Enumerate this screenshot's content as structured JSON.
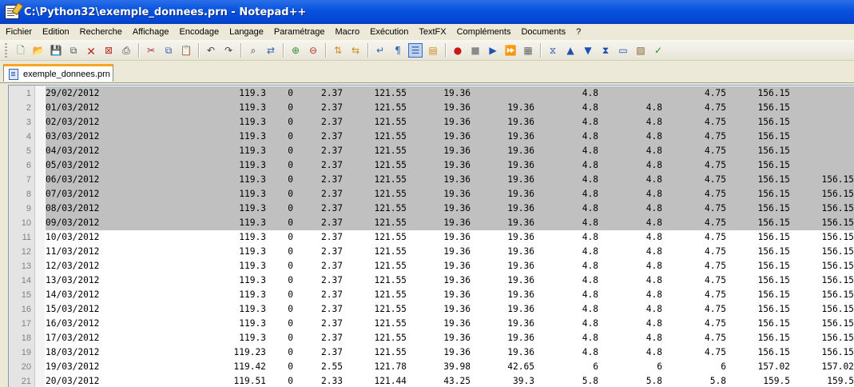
{
  "window": {
    "title": "C:\\Python32\\exemple_donnees.prn - Notepad++"
  },
  "menu": [
    "Fichier",
    "Edition",
    "Recherche",
    "Affichage",
    "Encodage",
    "Langage",
    "Paramétrage",
    "Macro",
    "Exécution",
    "TextFX",
    "Compléments",
    "Documents",
    "?"
  ],
  "toolbar": {
    "buttons": [
      {
        "name": "new-file-icon",
        "glyph": "🗋",
        "color": "#2e8b2e"
      },
      {
        "name": "open-file-icon",
        "glyph": "📂",
        "color": "#d9a520"
      },
      {
        "name": "save-icon",
        "glyph": "💾",
        "color": "#555"
      },
      {
        "name": "save-all-icon",
        "glyph": "⧉",
        "color": "#555"
      },
      {
        "name": "close-icon",
        "glyph": "🗙",
        "color": "#c03020"
      },
      {
        "name": "close-all-icon",
        "glyph": "⊠",
        "color": "#c03020"
      },
      {
        "name": "print-icon",
        "glyph": "⎙",
        "color": "#333"
      },
      {
        "sep": true
      },
      {
        "name": "cut-icon",
        "glyph": "✂",
        "color": "#b03030"
      },
      {
        "name": "copy-icon",
        "glyph": "⧉",
        "color": "#3062b0"
      },
      {
        "name": "paste-icon",
        "glyph": "📋",
        "color": "#a07030"
      },
      {
        "sep": true
      },
      {
        "name": "undo-icon",
        "glyph": "↶",
        "color": "#444"
      },
      {
        "name": "redo-icon",
        "glyph": "↷",
        "color": "#444"
      },
      {
        "sep": true
      },
      {
        "name": "find-icon",
        "glyph": "⌕",
        "color": "#333"
      },
      {
        "name": "replace-icon",
        "glyph": "⇄",
        "color": "#3062b0"
      },
      {
        "sep": true
      },
      {
        "name": "zoom-in-icon",
        "glyph": "⊕",
        "color": "#2e8b2e"
      },
      {
        "name": "zoom-out-icon",
        "glyph": "⊖",
        "color": "#c03020"
      },
      {
        "sep": true
      },
      {
        "name": "sync-vertical-icon",
        "glyph": "⇅",
        "color": "#d08a20"
      },
      {
        "name": "sync-horizontal-icon",
        "glyph": "⇆",
        "color": "#d08a20"
      },
      {
        "sep": true
      },
      {
        "name": "word-wrap-icon",
        "glyph": "↵",
        "color": "#3062b0"
      },
      {
        "name": "show-all-chars-icon",
        "glyph": "¶",
        "color": "#3062b0"
      },
      {
        "name": "indent-guide-icon",
        "glyph": "☰",
        "color": "#3062b0",
        "pressed": true
      },
      {
        "name": "user-lang-icon",
        "glyph": "▤",
        "color": "#d08a20"
      },
      {
        "sep": true
      },
      {
        "name": "record-macro-icon",
        "glyph": "●",
        "color": "#c81818"
      },
      {
        "name": "stop-macro-icon",
        "glyph": "■",
        "color": "#8a8a8a"
      },
      {
        "name": "play-macro-icon",
        "glyph": "▶",
        "color": "#1f4fb0"
      },
      {
        "name": "play-multiple-icon",
        "glyph": "⏩",
        "color": "#1f4fb0"
      },
      {
        "name": "save-macro-icon",
        "glyph": "▦",
        "color": "#666"
      },
      {
        "sep": true
      },
      {
        "name": "sort-icon",
        "glyph": "⧖",
        "color": "#1f4fb0"
      },
      {
        "name": "move-up-icon",
        "glyph": "▲",
        "color": "#1f4fb0"
      },
      {
        "name": "move-down-icon",
        "glyph": "▼",
        "color": "#1f4fb0"
      },
      {
        "name": "sort-lines-icon",
        "glyph": "⧗",
        "color": "#1f4fb0"
      },
      {
        "name": "console-icon",
        "glyph": "▭",
        "color": "#1f4fb0"
      },
      {
        "name": "plugin-icon",
        "glyph": "▧",
        "color": "#806030"
      },
      {
        "name": "spell-check-icon",
        "glyph": "✓",
        "color": "#2e8b2e"
      }
    ]
  },
  "tabs": [
    {
      "label": "exemple_donnees.prn",
      "active": true
    }
  ],
  "editor": {
    "selected_last_line": 10,
    "rows": [
      [
        "29/02/2012",
        "119.3",
        "0",
        "2.37",
        "121.55",
        "19.36",
        "",
        "4.8",
        "",
        "4.75",
        "156.15",
        ""
      ],
      [
        "01/03/2012",
        "119.3",
        "0",
        "2.37",
        "121.55",
        "19.36",
        "19.36",
        "4.8",
        "4.8",
        "4.75",
        "156.15",
        ""
      ],
      [
        "02/03/2012",
        "119.3",
        "0",
        "2.37",
        "121.55",
        "19.36",
        "19.36",
        "4.8",
        "4.8",
        "4.75",
        "156.15",
        ""
      ],
      [
        "03/03/2012",
        "119.3",
        "0",
        "2.37",
        "121.55",
        "19.36",
        "19.36",
        "4.8",
        "4.8",
        "4.75",
        "156.15",
        ""
      ],
      [
        "04/03/2012",
        "119.3",
        "0",
        "2.37",
        "121.55",
        "19.36",
        "19.36",
        "4.8",
        "4.8",
        "4.75",
        "156.15",
        ""
      ],
      [
        "05/03/2012",
        "119.3",
        "0",
        "2.37",
        "121.55",
        "19.36",
        "19.36",
        "4.8",
        "4.8",
        "4.75",
        "156.15",
        ""
      ],
      [
        "06/03/2012",
        "119.3",
        "0",
        "2.37",
        "121.55",
        "19.36",
        "19.36",
        "4.8",
        "4.8",
        "4.75",
        "156.15",
        "156.15"
      ],
      [
        "07/03/2012",
        "119.3",
        "0",
        "2.37",
        "121.55",
        "19.36",
        "19.36",
        "4.8",
        "4.8",
        "4.75",
        "156.15",
        "156.15"
      ],
      [
        "08/03/2012",
        "119.3",
        "0",
        "2.37",
        "121.55",
        "19.36",
        "19.36",
        "4.8",
        "4.8",
        "4.75",
        "156.15",
        "156.15"
      ],
      [
        "09/03/2012",
        "119.3",
        "0",
        "2.37",
        "121.55",
        "19.36",
        "19.36",
        "4.8",
        "4.8",
        "4.75",
        "156.15",
        "156.15"
      ],
      [
        "10/03/2012",
        "119.3",
        "0",
        "2.37",
        "121.55",
        "19.36",
        "19.36",
        "4.8",
        "4.8",
        "4.75",
        "156.15",
        "156.15"
      ],
      [
        "11/03/2012",
        "119.3",
        "0",
        "2.37",
        "121.55",
        "19.36",
        "19.36",
        "4.8",
        "4.8",
        "4.75",
        "156.15",
        "156.15"
      ],
      [
        "12/03/2012",
        "119.3",
        "0",
        "2.37",
        "121.55",
        "19.36",
        "19.36",
        "4.8",
        "4.8",
        "4.75",
        "156.15",
        "156.15"
      ],
      [
        "13/03/2012",
        "119.3",
        "0",
        "2.37",
        "121.55",
        "19.36",
        "19.36",
        "4.8",
        "4.8",
        "4.75",
        "156.15",
        "156.15"
      ],
      [
        "14/03/2012",
        "119.3",
        "0",
        "2.37",
        "121.55",
        "19.36",
        "19.36",
        "4.8",
        "4.8",
        "4.75",
        "156.15",
        "156.15"
      ],
      [
        "15/03/2012",
        "119.3",
        "0",
        "2.37",
        "121.55",
        "19.36",
        "19.36",
        "4.8",
        "4.8",
        "4.75",
        "156.15",
        "156.15"
      ],
      [
        "16/03/2012",
        "119.3",
        "0",
        "2.37",
        "121.55",
        "19.36",
        "19.36",
        "4.8",
        "4.8",
        "4.75",
        "156.15",
        "156.15"
      ],
      [
        "17/03/2012",
        "119.3",
        "0",
        "2.37",
        "121.55",
        "19.36",
        "19.36",
        "4.8",
        "4.8",
        "4.75",
        "156.15",
        "156.15"
      ],
      [
        "18/03/2012",
        "119.23",
        "0",
        "2.37",
        "121.55",
        "19.36",
        "19.36",
        "4.8",
        "4.8",
        "4.75",
        "156.15",
        "156.15"
      ],
      [
        "19/03/2012",
        "119.42",
        "0",
        "2.55",
        "121.78",
        "39.98",
        "42.65",
        "6",
        "6",
        "6",
        "157.02",
        "157.02"
      ],
      [
        "20/03/2012",
        "119.51",
        "0",
        "2.33",
        "121.44",
        "43.25",
        "39.3",
        "5.8",
        "5.8",
        "5.8",
        "159.5",
        "159.5"
      ]
    ]
  }
}
